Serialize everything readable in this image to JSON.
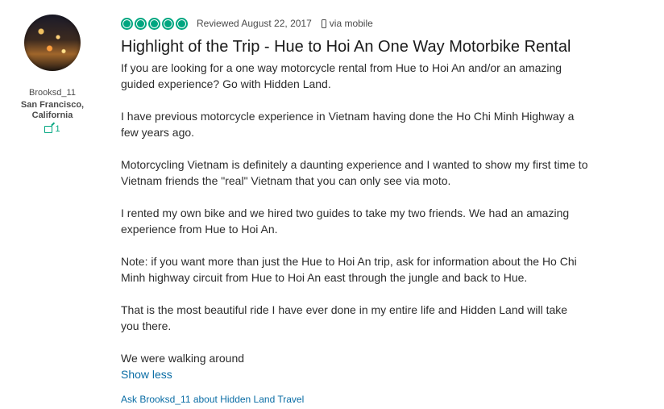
{
  "member": {
    "username": "Brooksd_11",
    "location_line1": "San Francisco,",
    "location_line2": "California",
    "contributions": "1",
    "icon": "review-count-icon"
  },
  "review": {
    "rating": 5,
    "date": "Reviewed August 22, 2017",
    "via": "via mobile",
    "title": "Highlight of the Trip - Hue to Hoi An One Way Motorbike Rental",
    "paragraphs": [
      "If you are looking for a one way motorcycle rental from Hue to Hoi An and/or an amazing guided experience? Go with Hidden Land.",
      "I have previous motorcycle experience in Vietnam having done the Ho Chi Minh Highway a few years ago.",
      "Motorcycling Vietnam is definitely a daunting experience and I wanted to show my first time to Vietnam friends the \"real\" Vietnam that you can only see via moto.",
      "I rented my own bike and we hired two guides to take my two friends. We had an amazing experience from Hue to Hoi An.",
      "Note: if you want more than just the Hue to Hoi An trip, ask for information about the Ho Chi Minh highway circuit from Hue to Hoi An east through the jungle and back to Hue.",
      "That is the most beautiful ride I have ever done in my entire life and Hidden Land will take you there.",
      "We were walking around"
    ],
    "show_less": "Show less",
    "ask": "Ask Brooksd_11 about Hidden Land Travel"
  },
  "colors": {
    "accent": "#00a680",
    "link": "#0a6da5"
  }
}
